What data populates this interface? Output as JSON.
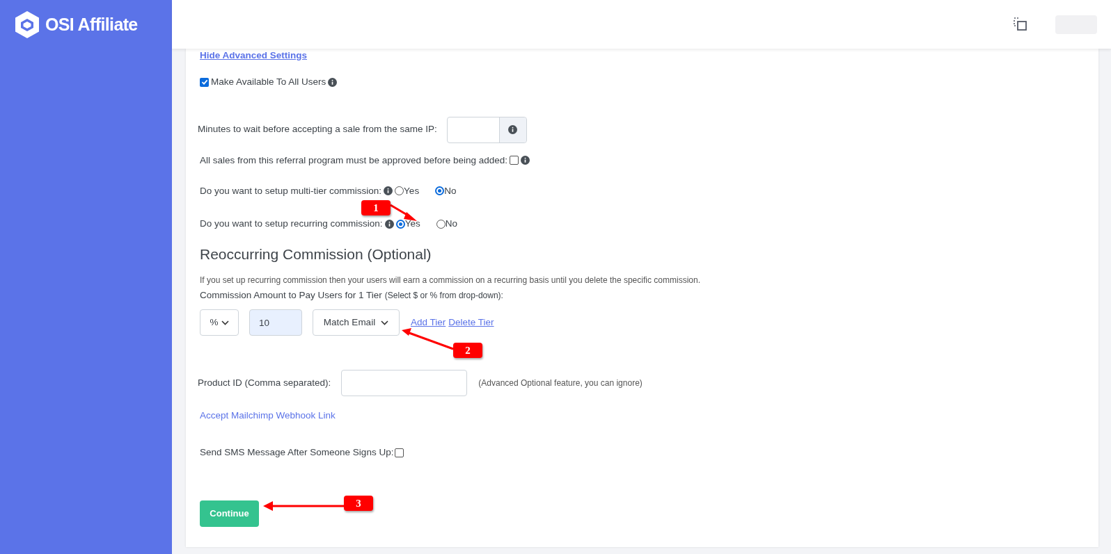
{
  "brand": {
    "name": "OSI Affiliate"
  },
  "advanced_link": "Hide Advanced Settings",
  "make_available": {
    "label": "Make Available To All Users",
    "checked": true
  },
  "minutes_wait": {
    "label": "Minutes to wait before accepting a sale from the same IP:"
  },
  "approve_sales": {
    "label": "All sales from this referral program must be approved before being added:",
    "checked": false
  },
  "multi_tier": {
    "label": "Do you want to setup multi-tier commission:",
    "options": [
      {
        "label": "Yes",
        "selected": false
      },
      {
        "label": "No",
        "selected": true
      }
    ]
  },
  "recurring": {
    "label": "Do you want to setup recurring commission:",
    "options": [
      {
        "label": "Yes",
        "selected": true
      },
      {
        "label": "No",
        "selected": false
      }
    ]
  },
  "section": {
    "title": "Reoccurring Commission (Optional)",
    "description": "If you set up recurring commission then your users will earn a commission on a recurring basis until you delete the specific commission.",
    "amount_label": "Commission Amount to Pay Users for 1 Tier",
    "amount_hint": "(Select $ or % from drop-down):"
  },
  "tier": {
    "unit": "%",
    "amount": "10",
    "match": "Match Email",
    "links": [
      "Add Tier",
      "Delete Tier"
    ]
  },
  "product_id": {
    "label": "Product ID (Comma separated):",
    "note": "(Advanced Optional feature, you can ignore)"
  },
  "mailchimp_link": "Accept Mailchimp Webhook Link",
  "sms": {
    "label": "Send SMS Message After Someone Signs Up:",
    "checked": false
  },
  "continue_button": "Continue",
  "annotations": [
    {
      "label": "1"
    },
    {
      "label": "2"
    },
    {
      "label": "3"
    }
  ]
}
